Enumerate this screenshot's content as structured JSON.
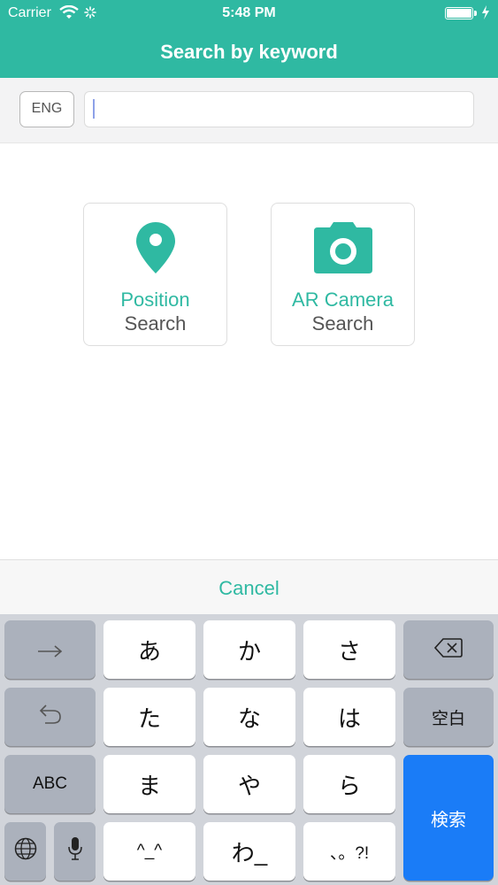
{
  "status_bar": {
    "carrier": "Carrier",
    "time": "5:48 PM",
    "battery_level_percent": 100
  },
  "nav": {
    "title": "Search by keyword"
  },
  "search": {
    "language_button": "ENG",
    "input_value": ""
  },
  "tiles": {
    "position": {
      "line1": "Position",
      "line2": "Search"
    },
    "ar_camera": {
      "line1": "AR Camera",
      "line2": "Search"
    }
  },
  "cancel": {
    "label": "Cancel"
  },
  "keyboard": {
    "next_arrow": "→",
    "undo": "↺",
    "abc": "ABC",
    "a": "あ",
    "ka": "か",
    "sa": "さ",
    "ta": "た",
    "na": "な",
    "ha": "は",
    "ma": "ま",
    "ya": "や",
    "ra": "ら",
    "kaomoji": "^_^",
    "wa": "わ_",
    "punct": "、。?!",
    "space": "空白",
    "search": "検索"
  },
  "colors": {
    "accent": "#2fb9a2",
    "keyboard_blue": "#1a7cf7"
  },
  "icons": [
    "wifi-icon",
    "activity-spinner-icon",
    "battery-icon",
    "charging-bolt-icon",
    "location-pin-icon",
    "camera-icon",
    "backspace-icon",
    "globe-icon",
    "microphone-icon"
  ]
}
